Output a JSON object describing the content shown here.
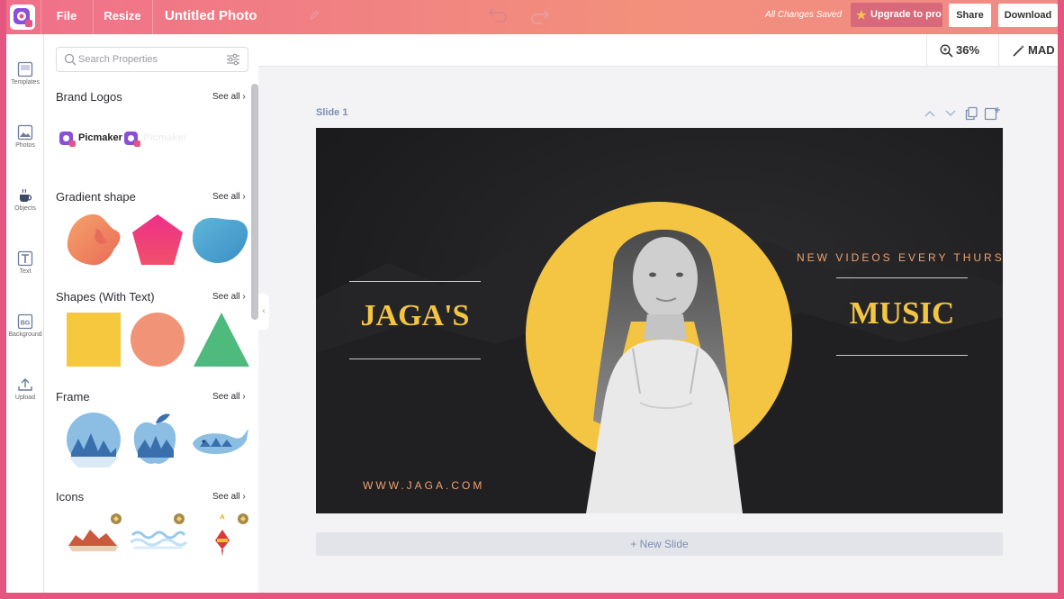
{
  "topbar": {
    "file_label": "File",
    "resize_label": "Resize",
    "doc_title": "Untitled Photo",
    "save_status": "All Changes Saved",
    "upgrade_label": "Upgrade to pro",
    "share_label": "Share",
    "download_label": "Download"
  },
  "rail": {
    "items": [
      {
        "label": "Templates",
        "icon": "templates-icon"
      },
      {
        "label": "Photos",
        "icon": "photos-icon"
      },
      {
        "label": "Objects",
        "icon": "objects-icon"
      },
      {
        "label": "Text",
        "icon": "text-icon"
      },
      {
        "label": "Background",
        "icon": "background-icon"
      },
      {
        "label": "Upload",
        "icon": "upload-icon"
      }
    ]
  },
  "panel": {
    "search_placeholder": "Search Properties",
    "see_all": "See all",
    "sections": [
      {
        "title": "Brand Logos"
      },
      {
        "title": "Gradient shape"
      },
      {
        "title": "Shapes (With Text)"
      },
      {
        "title": "Frame"
      },
      {
        "title": "Icons"
      }
    ],
    "brand_logo_text": "Picmaker"
  },
  "workspace": {
    "zoom": "36%",
    "user": "MAD",
    "slide_label": "Slide 1",
    "new_slide_label": "+ New Slide"
  },
  "slide": {
    "left_title": "JAGA'S",
    "right_title": "MUSIC",
    "tagline": "NEW VIDEOS EVERY THURSDAY",
    "website": "WWW.JAGA.COM",
    "colors": {
      "accent": "#f4c542",
      "tagline": "#f2a06d",
      "background": "#1f1f21"
    }
  },
  "colors": {
    "brand_pink": "#e4567f",
    "topbar_start": "#f0708a",
    "topbar_end": "#f2907c",
    "link_blue": "#7c8fb0"
  }
}
